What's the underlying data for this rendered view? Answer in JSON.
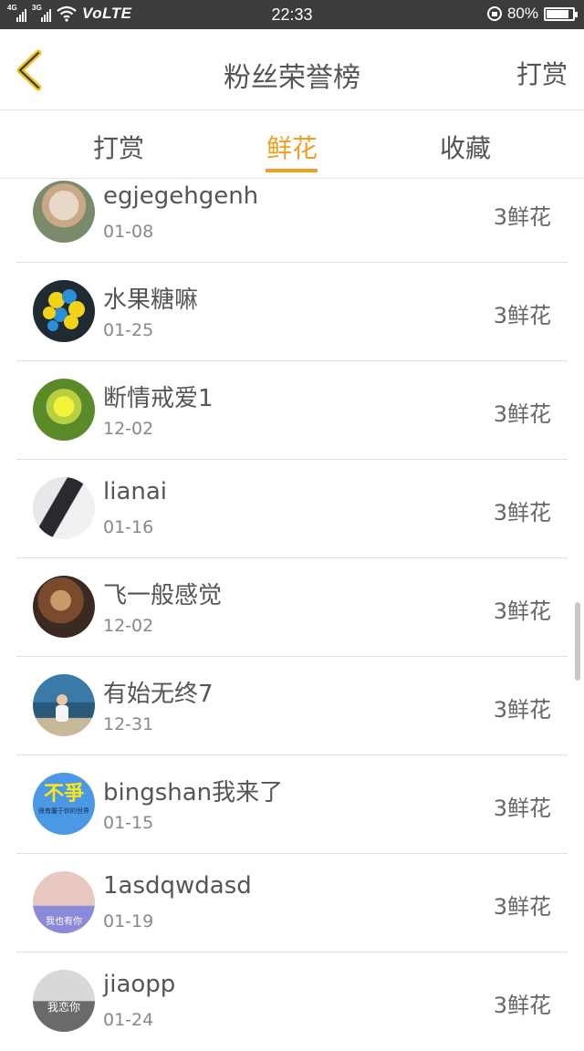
{
  "status_bar": {
    "network_1": "4G",
    "network_2": "3G",
    "volte": "VoLTE",
    "time": "22:33",
    "battery": "80%",
    "battery_level": 0.8
  },
  "header": {
    "title": "粉丝荣誉榜",
    "right_action": "打赏"
  },
  "tabs": [
    {
      "label": "打赏",
      "active": false
    },
    {
      "label": "鲜花",
      "active": true
    },
    {
      "label": "收藏",
      "active": false
    }
  ],
  "list": [
    {
      "name": "egjegehgenh",
      "date": "01-08",
      "amount": "3鲜花"
    },
    {
      "name": "水果糖嘛",
      "date": "01-25",
      "amount": "3鲜花"
    },
    {
      "name": "断情戒爱1",
      "date": "12-02",
      "amount": "3鲜花"
    },
    {
      "name": "lianai",
      "date": "01-16",
      "amount": "3鲜花"
    },
    {
      "name": "飞一般感觉",
      "date": "12-02",
      "amount": "3鲜花"
    },
    {
      "name": "有始无终7",
      "date": "12-31",
      "amount": "3鲜花"
    },
    {
      "name": "bingshan我来了",
      "date": "01-15",
      "amount": "3鲜花",
      "avatar_text": "不爭",
      "avatar_subtext": "很有屬于你的世界"
    },
    {
      "name": "1asdqwdasd",
      "date": "01-19",
      "amount": "3鲜花",
      "avatar_text": "我也有你"
    },
    {
      "name": "jiaopp",
      "date": "01-24",
      "amount": "3鲜花",
      "avatar_text": "我恋你"
    }
  ],
  "colors": {
    "accent": "#f0a020",
    "status_bar": "#3c3c3c",
    "divider": "#e2e2e2"
  }
}
